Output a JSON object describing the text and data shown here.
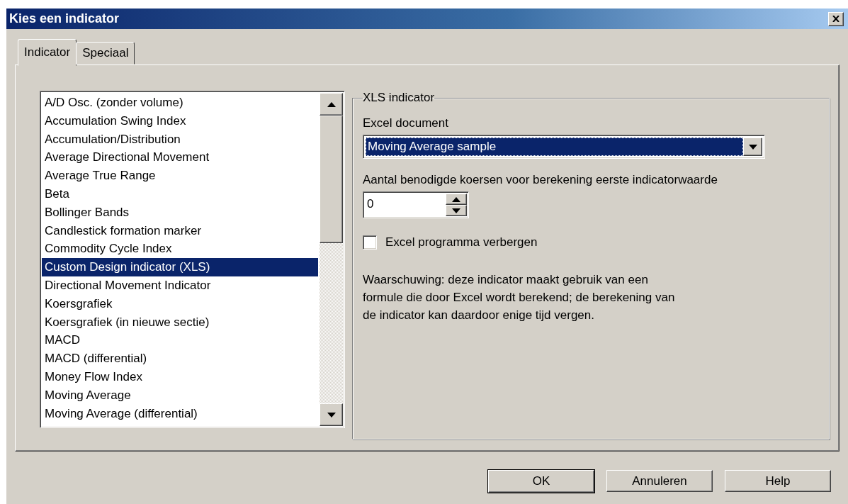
{
  "window": {
    "title": "Kies een indicator"
  },
  "tabs": [
    {
      "label": "Indicator",
      "selected": true
    },
    {
      "label": "Speciaal",
      "selected": false
    }
  ],
  "indicator_list": {
    "items": [
      {
        "label": "A/D Osc. (zonder volume)",
        "selected": false
      },
      {
        "label": "Accumulation Swing Index",
        "selected": false
      },
      {
        "label": "Accumulation/Distribution",
        "selected": false
      },
      {
        "label": "Average Directional Movement",
        "selected": false
      },
      {
        "label": "Average True Range",
        "selected": false
      },
      {
        "label": "Beta",
        "selected": false
      },
      {
        "label": "Bollinger Bands",
        "selected": false
      },
      {
        "label": "Candlestick formation marker",
        "selected": false
      },
      {
        "label": "Commodity Cycle Index",
        "selected": false
      },
      {
        "label": "Custom Design indicator (XLS)",
        "selected": true
      },
      {
        "label": "Directional Movement Indicator",
        "selected": false
      },
      {
        "label": "Koersgrafiek",
        "selected": false
      },
      {
        "label": "Koersgrafiek (in nieuwe sectie)",
        "selected": false
      },
      {
        "label": "MACD",
        "selected": false
      },
      {
        "label": "MACD (differential)",
        "selected": false
      },
      {
        "label": "Money Flow Index",
        "selected": false
      },
      {
        "label": "Moving Average",
        "selected": false
      },
      {
        "label": "Moving Average (differential)",
        "selected": false
      }
    ]
  },
  "xls_group": {
    "title": "XLS indicator",
    "document_label": "Excel document",
    "document_value": "Moving Average sample",
    "count_label": "Aantal benodigde koersen voor berekening eerste indicatorwaarde",
    "count_value": "0",
    "hide_excel": {
      "label": "Excel programma verbergen",
      "checked": false
    },
    "warning": "Waarschuwing: deze indicator maakt gebruik van een\nformule die door Excel wordt berekend; de berekening van\nde indicator kan daardoor enige tijd vergen."
  },
  "buttons": [
    {
      "label": "OK",
      "default": true
    },
    {
      "label": "Annuleren",
      "default": false
    },
    {
      "label": "Help",
      "default": false
    }
  ]
}
